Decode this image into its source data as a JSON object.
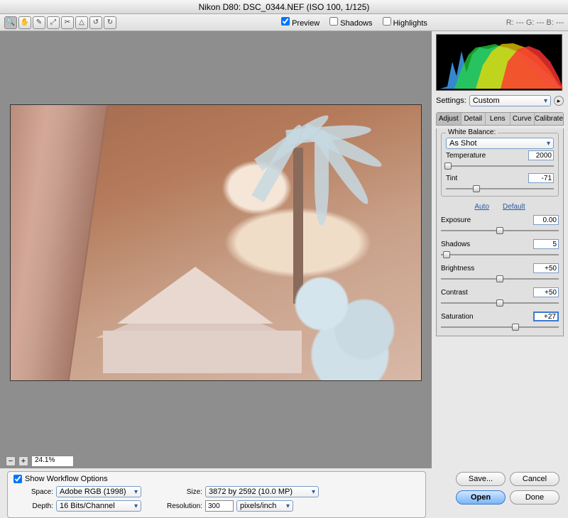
{
  "title": "Nikon D80:  DSC_0344.NEF  (ISO 100, 1/125)",
  "header": {
    "preview": "Preview",
    "shadows": "Shadows",
    "highlights": "Highlights",
    "rgb": "R: ---   G: ---   B: ---"
  },
  "zoom": {
    "minus": "−",
    "plus": "+",
    "value": "24.1%"
  },
  "settings": {
    "label": "Settings:",
    "value": "Custom"
  },
  "tabs": {
    "adjust": "Adjust",
    "detail": "Detail",
    "lens": "Lens",
    "curve": "Curve",
    "calibrate": "Calibrate"
  },
  "wb": {
    "legend": "White Balance:",
    "mode": "As Shot",
    "temp_label": "Temperature",
    "temp_value": "2000",
    "tint_label": "Tint",
    "tint_value": "-71"
  },
  "links": {
    "auto": "Auto",
    "default": "Default"
  },
  "sliders": {
    "exposure": {
      "label": "Exposure",
      "value": "0.00",
      "pos": 50
    },
    "shadows": {
      "label": "Shadows",
      "value": "5",
      "pos": 5
    },
    "brightness": {
      "label": "Brightness",
      "value": "+50",
      "pos": 50
    },
    "contrast": {
      "label": "Contrast",
      "value": "+50",
      "pos": 50
    },
    "saturation": {
      "label": "Saturation",
      "value": "+27",
      "pos": 63
    }
  },
  "workflow": {
    "check": "Show Workflow Options",
    "space_label": "Space:",
    "space_value": "Adobe RGB (1998)",
    "depth_label": "Depth:",
    "depth_value": "16 Bits/Channel",
    "size_label": "Size:",
    "size_value": "3872 by 2592  (10.0 MP)",
    "res_label": "Resolution:",
    "res_value": "300",
    "res_unit": "pixels/inch"
  },
  "buttons": {
    "save": "Save...",
    "cancel": "Cancel",
    "open": "Open",
    "done": "Done"
  }
}
